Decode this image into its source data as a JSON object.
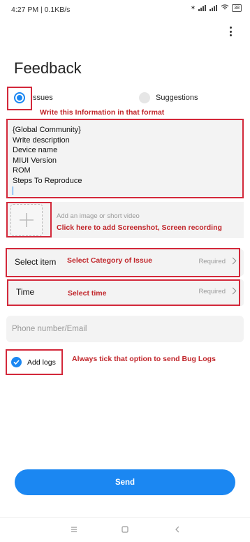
{
  "status_bar": {
    "time": "4:27 PM | 0.1KB/s",
    "battery": "38"
  },
  "page": {
    "title": "Feedback"
  },
  "tabs": {
    "issues": "Issues",
    "suggestions": "Suggestions"
  },
  "annotations": {
    "write_info": "Write this Information in that format",
    "add_media": "Click here to add Screenshot, Screen recording",
    "select_category": "Select Category of Issue",
    "select_time": "Select time",
    "tick_logs": "Always tick that option to send Bug Logs"
  },
  "description": {
    "value": "{Global Community}\nWrite description\nDevice name\nMIUI Version\nROM\nSteps To Reproduce"
  },
  "media": {
    "hint": "Add an image or short video"
  },
  "select_item": {
    "label": "Select item",
    "status": "Required"
  },
  "time": {
    "label": "Time",
    "status": "Required"
  },
  "contact": {
    "placeholder": "Phone number/Email"
  },
  "logs": {
    "label": "Add logs",
    "checked": true
  },
  "send": {
    "label": "Send"
  },
  "colors": {
    "accent": "#1b87f2",
    "annotation_red": "#c1252a",
    "field_bg": "#f3f3f3"
  },
  "icons": [
    "more-vertical-icon",
    "plus-icon",
    "chevron-right-icon",
    "check-icon",
    "menu-icon",
    "home-icon",
    "back-icon"
  ]
}
